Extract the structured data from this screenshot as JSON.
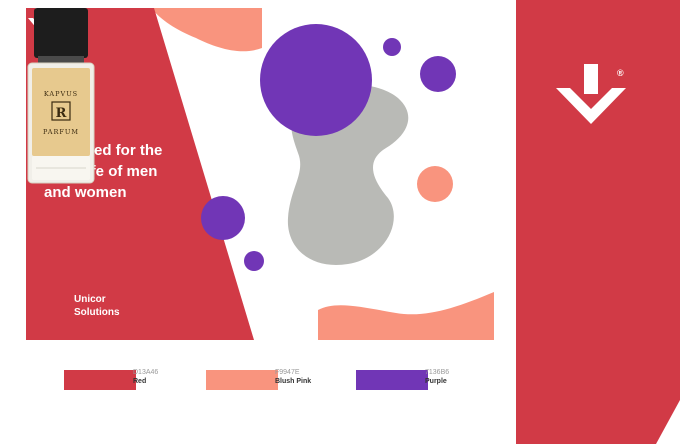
{
  "headline": {
    "line1": "Designed for the",
    "line2": "daily life of men",
    "line3": "and women"
  },
  "logo": {
    "line1": "Unicor",
    "line2": "Solutions",
    "registered_mark": "®"
  },
  "bottle_label": {
    "top": "KAPVUS",
    "monogram": "R",
    "bottom": "PARFUM"
  },
  "colors": {
    "red": "#D13A46",
    "blush_pink": "#F9947E",
    "purple": "#7136B6",
    "grey_blob": "#B9BAB6"
  },
  "swatches": [
    {
      "code": "D13A46",
      "name": "Red",
      "color": "#D13A46"
    },
    {
      "code": "F9947E",
      "name": "Blush Pink",
      "color": "#F9947E"
    },
    {
      "code": "7136B6",
      "name": "Purple",
      "color": "#7136B6"
    }
  ]
}
